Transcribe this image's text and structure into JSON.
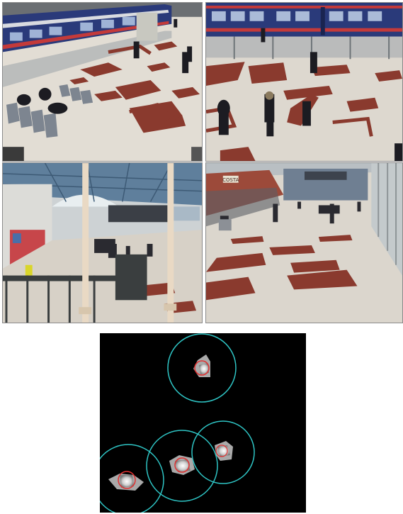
{
  "figure": {
    "panels": [
      {
        "id": "camera-top-left",
        "scene": "platform-concourse-with-train"
      },
      {
        "id": "camera-top-right",
        "scene": "walkway-beside-train"
      },
      {
        "id": "camera-bottom-left",
        "scene": "station-hall-overview"
      },
      {
        "id": "camera-bottom-right",
        "scene": "concourse-shops"
      }
    ],
    "tracking_map": {
      "background": "#000000",
      "circle_color": "#2ec4c4",
      "marker_color": "#e03030",
      "blob_color": "#c8c8c8",
      "target_count": 4
    },
    "shop_sign": "COSTA"
  },
  "colors": {
    "floor": "#d9d3c9",
    "tile_pattern": "#8a3a2e",
    "train_body": "#2a3a7a",
    "train_stripe": "#c43a3a"
  }
}
